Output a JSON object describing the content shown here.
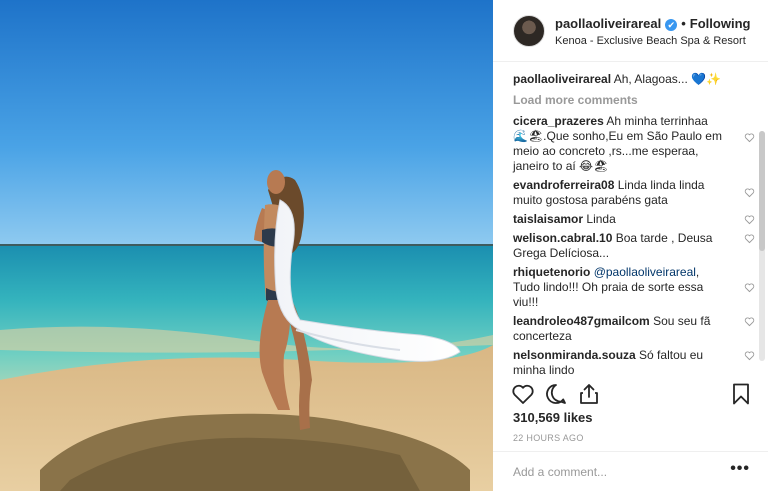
{
  "header": {
    "username": "paollaoliveirareal",
    "verified_badge": "✔",
    "separator": "•",
    "follow_status": "Following",
    "location": "Kenoa - Exclusive Beach Spa & Resort"
  },
  "caption": {
    "username": "paollaoliveirareal",
    "text": "Ah, Alagoas... 💙✨"
  },
  "load_more_label": "Load more comments",
  "comments": [
    {
      "username": "cicera_prazeres",
      "text": "Ah minha terrinhaa 🌊🏖.Que sonho,Eu em São Paulo em meio ao concreto ,rs...me esperaa, janeiro to aí 😂🏖"
    },
    {
      "username": "evandroferreira08",
      "text": "Linda linda linda muito gostosa parabéns gata"
    },
    {
      "username": "taislaisamor",
      "text": "Linda"
    },
    {
      "username": "welison.cabral.10",
      "text": "Boa tarde , Deusa Grega Delíciosa..."
    },
    {
      "username": "rhiquetenorio",
      "mention": "@paollaoliveirareal",
      "text": ", Tudo lindo!!! Oh praia de sorte essa viu!!!"
    },
    {
      "username": "leandroleo487gmailcom",
      "text": "Sou seu fã concerteza"
    },
    {
      "username": "nelsonmiranda.souza",
      "text": "Só faltou eu minha lindo"
    }
  ],
  "icons": {
    "like": "heart-outline-icon",
    "comment": "speech-bubble-icon",
    "share": "share-upload-icon",
    "save": "bookmark-icon",
    "comment_like": "small-heart-icon",
    "more": "ellipsis-icon"
  },
  "likes_text": "310,569 likes",
  "timestamp": "22 HOURS AGO",
  "add_comment": {
    "placeholder": "Add a comment...",
    "more_label": "•••"
  },
  "colors": {
    "text": "#262626",
    "muted": "#999999",
    "link": "#003569",
    "verified": "#3897f0",
    "divider": "#efefef"
  }
}
